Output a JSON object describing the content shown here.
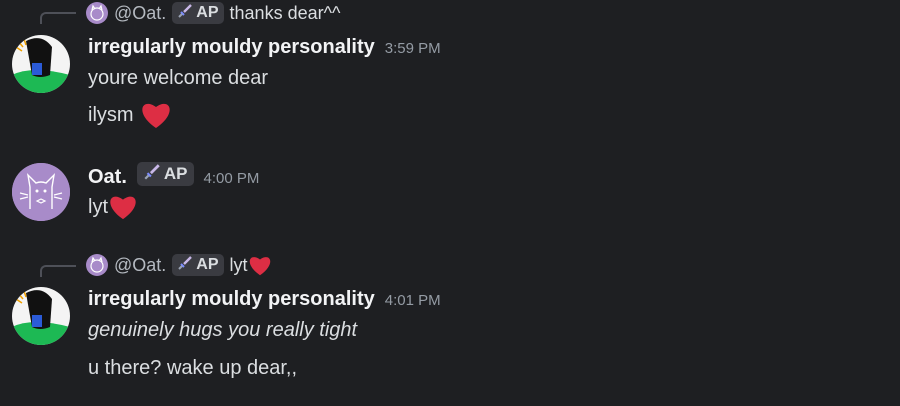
{
  "messages": [
    {
      "reply": {
        "mention": "@Oat.",
        "tag": "AP",
        "text": "thanks dear^^"
      },
      "author": "irregularly mouldy personality",
      "time": "3:59 PM",
      "lines": [
        "youre welcome dear",
        "ilysm"
      ]
    },
    {
      "author": "Oat.",
      "tag": "AP",
      "time": "4:00 PM",
      "lines": [
        "lyt"
      ]
    },
    {
      "reply": {
        "mention": "@Oat.",
        "tag": "AP",
        "text": "lyt"
      },
      "author": "irregularly mouldy personality",
      "time": "4:01 PM",
      "lines": [
        "genuinely hugs you really tight",
        "u there? wake up dear,,"
      ]
    }
  ],
  "colors": {
    "background": "#1e1f22",
    "username": "#f2f3f5",
    "timestamp": "#949ba4",
    "heart": "#dd2e44",
    "oat_avatar": "#a88bc9"
  },
  "icons": {
    "heart": "red-heart-emoji",
    "tag": "sword-icon"
  }
}
